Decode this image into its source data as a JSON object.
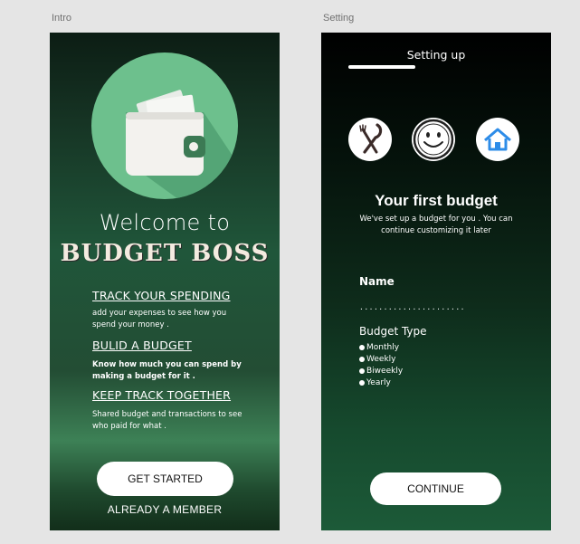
{
  "artboards": {
    "intro_label": "Intro",
    "setting_label": "Setting"
  },
  "intro": {
    "welcome": "Welcome to",
    "brand": "BUDGET BOSS",
    "features": [
      {
        "title": "TRACK YOUR SPENDING",
        "desc_line1": "add your expenses to see how you",
        "desc_line2": "spend your money ."
      },
      {
        "title": "BULID A BUDGET",
        "desc_line1": "Know how much you can spend by",
        "desc_line2": "making a budget for it ."
      },
      {
        "title": "KEEP TRACK TOGETHER",
        "desc_line1": "Shared budget and transactions to see",
        "desc_line2": "who paid for what ."
      }
    ],
    "get_started": "GET STARTED",
    "already_member": "ALREADY A MEMBER",
    "hero_icon": "wallet-icon"
  },
  "setting": {
    "header": "Setting up",
    "progress": 0.33,
    "category_icons": [
      "fork-knife-icon",
      "smiley-icon",
      "home-icon"
    ],
    "title": "Your first budget",
    "subtitle_line1": "We've set up a budget for you . You can",
    "subtitle_line2": "continue customizing it later",
    "name_label": "Name",
    "name_value": "............................",
    "budget_type_label": "Budget Type",
    "budget_types": [
      "Monthly",
      "Weekly",
      "Biweekly",
      "Yearly"
    ],
    "continue": "CONTINUE"
  },
  "colors": {
    "wallet_circle": "#6dc08d",
    "home_icon": "#2d8ce8",
    "button_bg": "#ffffff"
  }
}
